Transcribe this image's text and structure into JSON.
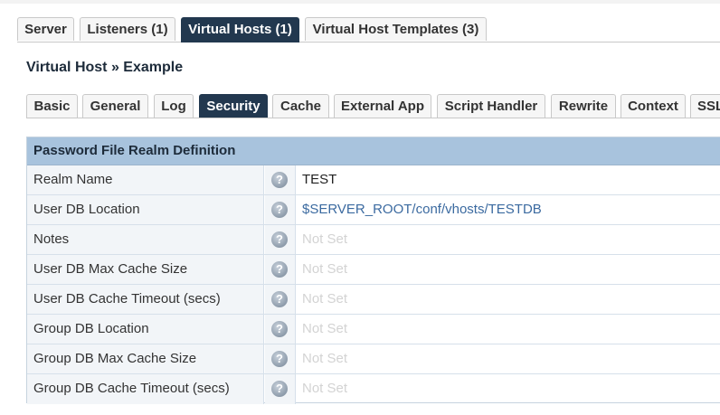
{
  "top_tabs": [
    {
      "label": "Server",
      "active": false
    },
    {
      "label": "Listeners (1)",
      "active": false
    },
    {
      "label": "Virtual Hosts (1)",
      "active": true
    },
    {
      "label": "Virtual Host Templates (3)",
      "active": false
    }
  ],
  "section_title": "Virtual Host » Example",
  "sub_tabs": [
    {
      "label": "Basic",
      "active": false
    },
    {
      "label": "General",
      "active": false
    },
    {
      "label": "Log",
      "active": false
    },
    {
      "label": "Security",
      "active": true
    },
    {
      "label": "Cache",
      "active": false
    },
    {
      "label": "External App",
      "active": false
    },
    {
      "label": "Script Handler",
      "active": false
    },
    {
      "label": "Rewrite",
      "active": false
    },
    {
      "label": "Context",
      "active": false
    },
    {
      "label": "SSL",
      "active": false
    }
  ],
  "panel": {
    "title": "Password File Realm Definition",
    "help_glyph": "?",
    "rows": [
      {
        "label": "Realm Name",
        "value": "TEST",
        "style": "plain"
      },
      {
        "label": "User DB Location",
        "value": "$SERVER_ROOT/conf/vhosts/TESTDB",
        "style": "link"
      },
      {
        "label": "Notes",
        "value": "Not Set",
        "style": "notset"
      },
      {
        "label": "User DB Max Cache Size",
        "value": "Not Set",
        "style": "notset"
      },
      {
        "label": "User DB Cache Timeout (secs)",
        "value": "Not Set",
        "style": "notset"
      },
      {
        "label": "Group DB Location",
        "value": "Not Set",
        "style": "notset"
      },
      {
        "label": "Group DB Max Cache Size",
        "value": "Not Set",
        "style": "notset"
      },
      {
        "label": "Group DB Cache Timeout (secs)",
        "value": "Not Set",
        "style": "notset"
      }
    ]
  },
  "colors": {
    "active_tab": "#22384f",
    "panel_header": "#a8c3dd",
    "link_value": "#3b6aa0",
    "not_set": "#d3d3d3"
  }
}
